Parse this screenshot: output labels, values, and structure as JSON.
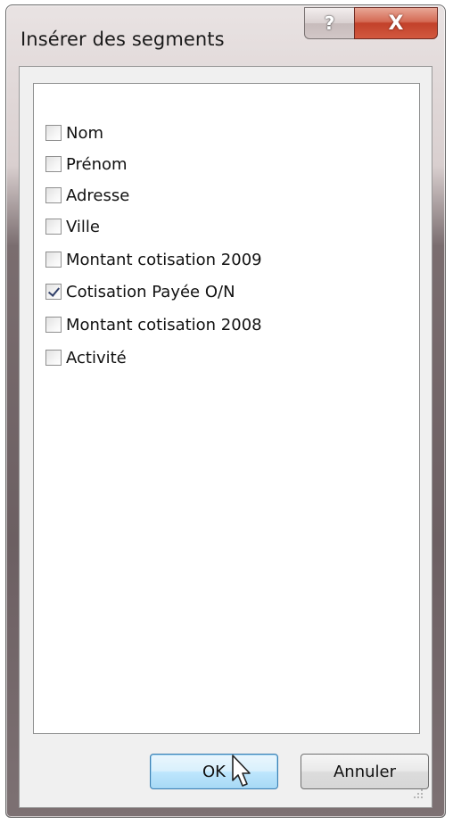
{
  "dialog": {
    "title": "Insérer des segments",
    "help_glyph": "?",
    "close_glyph": "X"
  },
  "fields": [
    {
      "label": "Nom",
      "checked": false
    },
    {
      "label": "Prénom",
      "checked": false
    },
    {
      "label": "Adresse",
      "checked": false
    },
    {
      "label": "Ville",
      "checked": false
    },
    {
      "label": "Montant cotisation 2009",
      "checked": false
    },
    {
      "label": "Cotisation Payée O/N",
      "checked": true
    },
    {
      "label": "Montant cotisation 2008",
      "checked": false
    },
    {
      "label": "Activité",
      "checked": false
    }
  ],
  "buttons": {
    "ok_label": "OK",
    "cancel_label": "Annuler"
  },
  "icons": {
    "help": "help-icon",
    "close": "close-icon",
    "cursor": "mouse-pointer-icon",
    "grip": "resize-grip-icon"
  }
}
